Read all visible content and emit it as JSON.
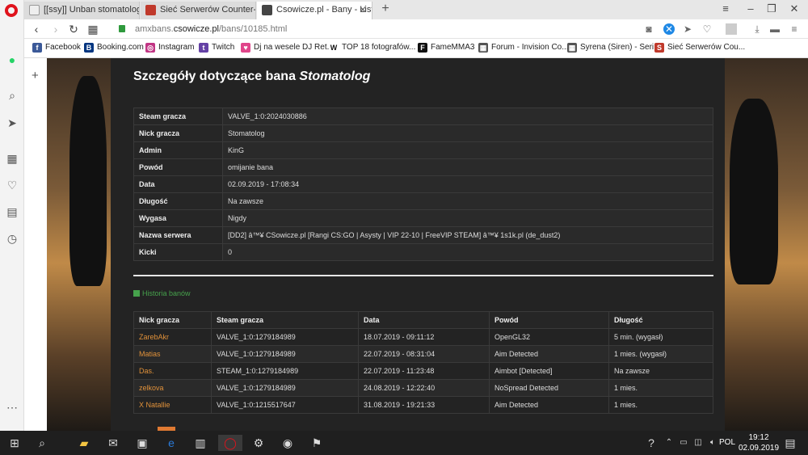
{
  "browser": {
    "tabs": [
      {
        "title": "[[ssy]] Unban stomatolog - ",
        "active": false
      },
      {
        "title": "Sieć Serwerów Counter-Str",
        "active": false
      },
      {
        "title": "Csowicze.pl - Bany - Lista b",
        "active": true
      }
    ],
    "url_host": "amxbans.",
    "url_domain": "csowicze.pl",
    "url_path": "/bans/10185.html",
    "bookmarks": [
      {
        "label": "Facebook",
        "icon": "f",
        "color": "#3b5998"
      },
      {
        "label": "Booking.com",
        "icon": "B",
        "color": "#003580"
      },
      {
        "label": "Instagram",
        "icon": "◎",
        "color": "#c13584"
      },
      {
        "label": "Twitch",
        "icon": "t",
        "color": "#6441a5"
      },
      {
        "label": "Dj na wesele DJ Ret...",
        "icon": "♥",
        "color": "#e0458a"
      },
      {
        "label": "TOP 18 fotografów...",
        "icon": "W",
        "color": "#ffffff"
      },
      {
        "label": "FameMMA3",
        "icon": "F",
        "color": "#111111"
      },
      {
        "label": "Forum - Invision Co...",
        "icon": "▦",
        "color": "#555555"
      },
      {
        "label": "Syrena (Siren) - Seri...",
        "icon": "▦",
        "color": "#555555"
      },
      {
        "label": "Sieć Serwerów Cou...",
        "icon": "S",
        "color": "#c0392b"
      }
    ]
  },
  "page": {
    "title_prefix": "Szczegóły dotyczące bana",
    "title_name": "Stomatolog",
    "details": [
      {
        "key": "Steam gracza",
        "value": "VALVE_1:0:2024030886"
      },
      {
        "key": "Nick gracza",
        "value": "Stomatolog"
      },
      {
        "key": "Admin",
        "value": "KinG"
      },
      {
        "key": "Powód",
        "value": "omijanie bana"
      },
      {
        "key": "Data",
        "value": "02.09.2019 - 17:08:34"
      },
      {
        "key": "Długość",
        "value": "Na zawsze"
      },
      {
        "key": "Wygasa",
        "value": "Nigdy"
      },
      {
        "key": "Nazwa serwera",
        "value": "[DD2] â™¥ CSowicze.pl [Rangi CS:GO | Asysty | VIP 22-10 | FreeVIP STEAM] â™¥ 1s1k.pl (de_dust2)"
      },
      {
        "key": "Kicki",
        "value": "0"
      }
    ],
    "history_label": "Historia banów",
    "history_headers": [
      "Nick gracza",
      "Steam gracza",
      "Data",
      "Powód",
      "Długość"
    ],
    "history_rows": [
      [
        "ZarebAkr",
        "VALVE_1:0:1279184989",
        "18.07.2019 - 09:11:12",
        "OpenGL32",
        "5 min. (wygasł)"
      ],
      [
        "Matias",
        "VALVE_1:0:1279184989",
        "22.07.2019 - 08:31:04",
        "Aim Detected",
        "1 mies. (wygasł)"
      ],
      [
        "Das.",
        "STEAM_1:0:1279184989",
        "22.07.2019 - 11:23:48",
        "Aimbot [Detected]",
        "Na zawsze"
      ],
      [
        "zelkova",
        "VALVE_1:0:1279184989",
        "24.08.2019 - 12:22:40",
        "NoSpread Detected",
        "1 mies."
      ],
      [
        "X Natallie",
        "VALVE_1:0:1215517647",
        "31.08.2019 - 19:21:33",
        "Aim Detected",
        "1 mies."
      ]
    ]
  },
  "taskbar": {
    "time": "19:12",
    "date": "02.09.2019",
    "lang": "POL"
  }
}
